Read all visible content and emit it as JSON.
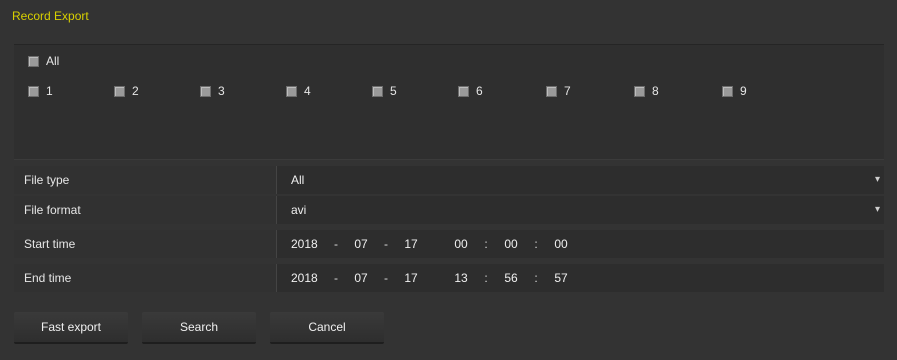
{
  "window": {
    "title": "Record Export"
  },
  "channels": {
    "all_label": "All",
    "items": [
      {
        "label": "1"
      },
      {
        "label": "2"
      },
      {
        "label": "3"
      },
      {
        "label": "4"
      },
      {
        "label": "5"
      },
      {
        "label": "6"
      },
      {
        "label": "7"
      },
      {
        "label": "8"
      },
      {
        "label": "9"
      }
    ]
  },
  "form": {
    "file_type": {
      "label": "File type",
      "value": "All"
    },
    "file_format": {
      "label": "File format",
      "value": "avi"
    },
    "start_time": {
      "label": "Start time",
      "year": "2018",
      "month": "07",
      "day": "17",
      "hour": "00",
      "minute": "00",
      "second": "00"
    },
    "end_time": {
      "label": "End time",
      "year": "2018",
      "month": "07",
      "day": "17",
      "hour": "13",
      "minute": "56",
      "second": "57"
    },
    "date_sep": "-",
    "time_sep": ":"
  },
  "buttons": {
    "fast_export": "Fast export",
    "search": "Search",
    "cancel": "Cancel"
  },
  "colors": {
    "title": "#d8d000",
    "background": "#333333"
  }
}
